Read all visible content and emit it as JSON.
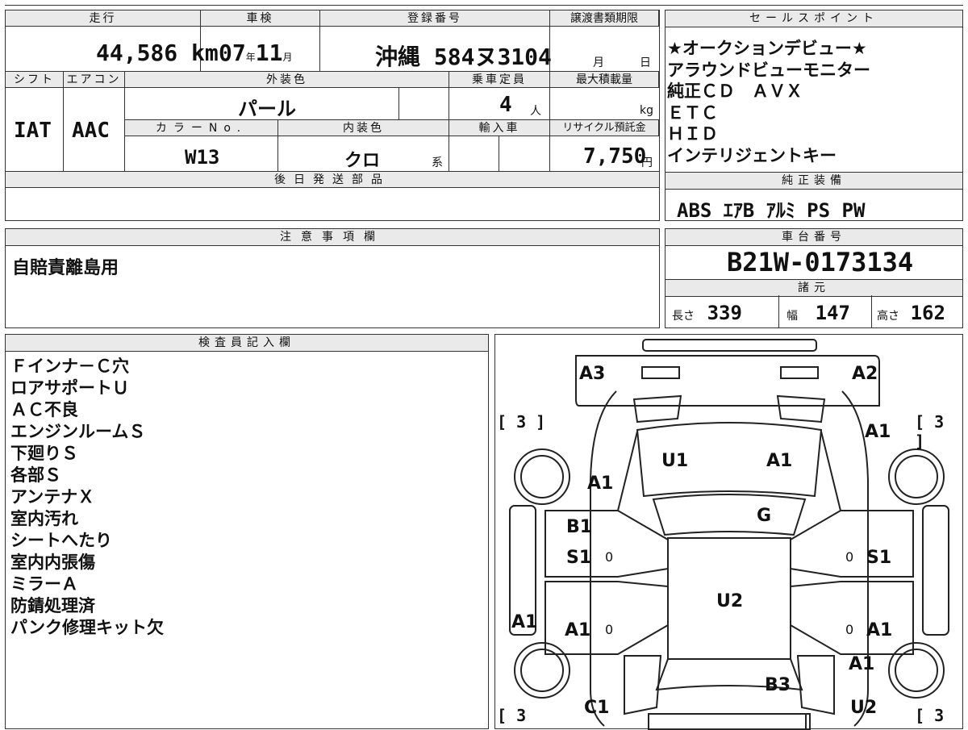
{
  "top_strip": "",
  "main_table": {
    "mileage_label": "走行",
    "mileage_value": "44,586",
    "mileage_unit": "km",
    "inspection_label": "車検",
    "inspection_year": "07",
    "inspection_year_unit": "年",
    "inspection_month": "11",
    "inspection_month_unit": "月",
    "registration_label": "登録番号",
    "registration_region": "沖縄",
    "registration_number": "584ヌ3104",
    "transfer_label": "譲渡書類期限",
    "transfer_month_unit": "月",
    "transfer_day_unit": "日",
    "shift_label": "シフト",
    "shift_value": "IAT",
    "ac_label": "エアコン",
    "ac_value": "AAC",
    "exterior_color_label": "外装色",
    "exterior_color_value": "パール",
    "capacity_label": "乗車定員",
    "capacity_value": "4",
    "capacity_unit": "人",
    "max_load_label": "最大積載量",
    "max_load_unit": "kg",
    "color_no_label": "カラーNo.",
    "color_no_value": "W13",
    "interior_color_label": "内装色",
    "interior_color_value": "クロ",
    "interior_color_suffix": "系",
    "import_label": "輸入車",
    "recycle_label": "リサイクル預託金",
    "recycle_value": "7,750",
    "recycle_unit": "円",
    "later_parts_label": "後日発送部品"
  },
  "sales_points": {
    "header": "セールスポイント",
    "items": [
      "★オークションデビュー★",
      "アラウンドビューモニター",
      "純正ＣＤ　ＡＶＸ",
      "ＥＴＣ",
      "ＨＩＤ",
      "インテリジェントキー"
    ]
  },
  "equipment": {
    "header": "純正装備",
    "value": "ABS ｴｱB ｱﾙﾐ PS PW"
  },
  "notes": {
    "header": "注意事項欄",
    "text": "自賠責離島用"
  },
  "chassis": {
    "header": "車台番号",
    "value": "B21W-0173134",
    "spec_header": "諸元",
    "length_label": "長さ",
    "length_value": "339",
    "width_label": "幅",
    "width_value": "147",
    "height_label": "高さ",
    "height_value": "162"
  },
  "inspector": {
    "header": "検査員記入欄",
    "lines": [
      "Ｆインナ－Ｃ穴",
      "ロアサポートＵ",
      "ＡＣ不良",
      "エンジンルームＳ",
      "下廻りＳ",
      "各部Ｓ",
      "アンテナＸ",
      "室内汚れ",
      "シートへたり",
      "室内内張傷",
      "ミラーＡ",
      "防錆処理済",
      "パンク修理キット欠"
    ]
  },
  "diagram": {
    "labels": {
      "front_left": "A3",
      "front_right": "A2",
      "hood_left": "U1",
      "hood_right": "A1",
      "fender_left": "A1",
      "fender_right": "A1",
      "windshield": "G",
      "door_l1_top": "B1",
      "door_l1_mid": "S1",
      "door_r1_mid": "S1",
      "roof": "U2",
      "sill_left": "A1",
      "door_l2": "A1",
      "door_r2": "A1",
      "rear_right": "A1",
      "rear": "B3",
      "rear_left_bottom": "C1",
      "rear_right_bottom": "U2"
    },
    "tire_brackets": {
      "top_left": "[ 3 ]",
      "top_right": "[ 3 ]",
      "bottom_left": "[ 3",
      "bottom_right": "[ 3"
    },
    "zeros": [
      "0",
      "0",
      "0",
      "0"
    ]
  }
}
